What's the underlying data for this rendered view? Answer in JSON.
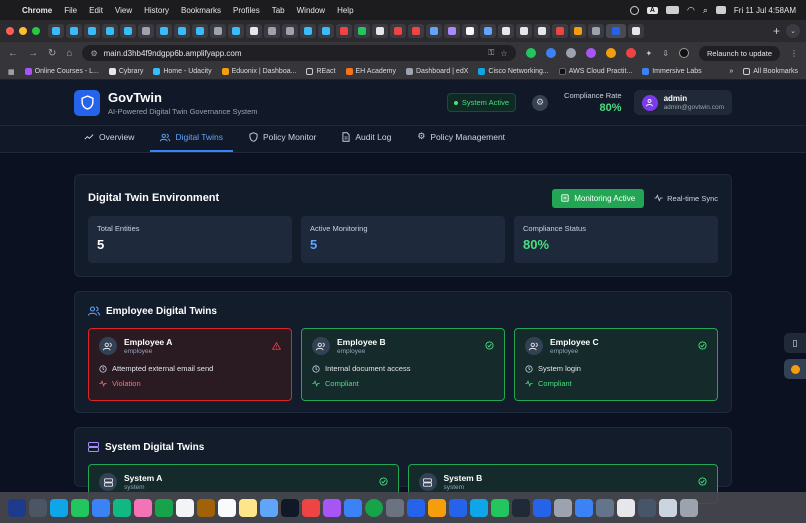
{
  "menubar": {
    "app": "Chrome",
    "items": [
      "File",
      "Edit",
      "View",
      "History",
      "Bookmarks",
      "Profiles",
      "Tab",
      "Window",
      "Help"
    ],
    "clock": "Fri 11 Jul  4:58AM",
    "input_badge": "A"
  },
  "browser": {
    "url": "main.d3hb4f9ndgpp6b.amplifyapp.com",
    "relaunch": "Relaunch to update",
    "bookmarks": [
      "Online Courses - L...",
      "Cybrary",
      "Home - Udacity",
      "Eduonix | Dashboa...",
      "REact",
      "EH Academy",
      "Dashboard | edX",
      "Cisco Networking...",
      "AWS Cloud Practit...",
      "Immersive Labs"
    ],
    "more": "»",
    "all_bookmarks": "All Bookmarks"
  },
  "colors": {
    "accent": "#3b82f6",
    "success": "#22a654",
    "danger": "#dc2626",
    "page_bg": "#0b1120",
    "panel_bg": "#131c2b"
  },
  "app": {
    "title": "GovTwin",
    "subtitle": "AI-Powered Digital Twin Governance System",
    "system_status": "System Active",
    "compliance_label": "Compliance Rate",
    "compliance_value": "80%",
    "user": {
      "name": "admin",
      "email": "admin@govtwin.com"
    }
  },
  "tabs": [
    {
      "label": "Overview",
      "icon": "chart-line-icon",
      "active": false
    },
    {
      "label": "Digital Twins",
      "icon": "users-icon",
      "active": true
    },
    {
      "label": "Policy Monitor",
      "icon": "shield-icon",
      "active": false
    },
    {
      "label": "Audit Log",
      "icon": "document-icon",
      "active": false
    },
    {
      "label": "Policy Management",
      "icon": "gear-icon",
      "active": false
    }
  ],
  "environment": {
    "title": "Digital Twin Environment",
    "monitor_button": "Monitoring Active",
    "sync_label": "Real-time Sync",
    "stats": [
      {
        "label": "Total Entities",
        "value": "5",
        "color": "#ffffff"
      },
      {
        "label": "Active Monitoring",
        "value": "5",
        "color": "#60a5fa"
      },
      {
        "label": "Compliance Status",
        "value": "80%",
        "color": "#4ade80"
      }
    ]
  },
  "employees": {
    "title": "Employee Digital Twins",
    "cards": [
      {
        "name": "Employee A",
        "type": "employee",
        "activity": "Attempted external email send",
        "status": "Violation",
        "state": "bad"
      },
      {
        "name": "Employee B",
        "type": "employee",
        "activity": "Internal document access",
        "status": "Compliant",
        "state": "good"
      },
      {
        "name": "Employee C",
        "type": "employee",
        "activity": "System login",
        "status": "Compliant",
        "state": "good"
      }
    ]
  },
  "systems": {
    "title": "System Digital Twins",
    "cards": [
      {
        "name": "System A",
        "type": "system"
      },
      {
        "name": "System B",
        "type": "system"
      }
    ]
  }
}
